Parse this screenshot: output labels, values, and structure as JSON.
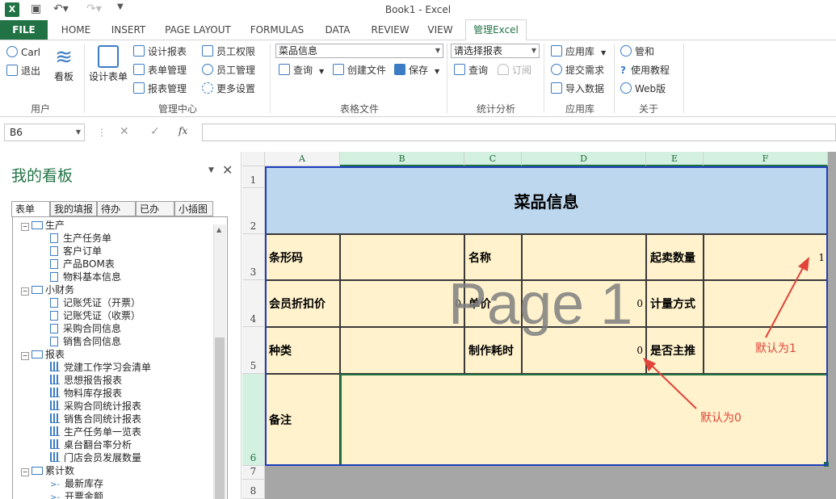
{
  "window": {
    "title": "Book1 - Excel"
  },
  "ribbon_tabs": [
    "FILE",
    "HOME",
    "INSERT",
    "PAGE LAYOUT",
    "FORMULAS",
    "DATA",
    "REVIEW",
    "VIEW",
    "管理Excel"
  ],
  "ribbon": {
    "user": {
      "carl": "Carl",
      "logout": "退出",
      "kanban": "看板",
      "group": "用户"
    },
    "manage": {
      "design_form": "设计表单",
      "design_report": "设计报表",
      "form_mgmt": "表单管理",
      "report_mgmt": "报表管理",
      "employee_perm": "员工权限",
      "employee_mgmt": "员工管理",
      "more_settings": "更多设置",
      "group": "管理中心"
    },
    "table_file": {
      "combo_value": "菜品信息",
      "query": "查询",
      "create_file": "创建文件",
      "save": "保存",
      "group": "表格文件"
    },
    "stats": {
      "combo_value": "请选择报表",
      "query": "查询",
      "subscribe": "订阅",
      "group": "统计分析"
    },
    "apps": {
      "app_store": "应用库",
      "submit_req": "提交需求",
      "import_data": "导入数据",
      "group": "应用库"
    },
    "about": {
      "official": "管和",
      "tutorial": "使用教程",
      "web": "Web版",
      "group": "关于"
    }
  },
  "formula_bar": {
    "name_box": "B6",
    "fx": "fx",
    "cancel": "✕",
    "enter": "✓",
    "value": ""
  },
  "pane": {
    "title": "我的看板",
    "tabs": [
      "表单",
      "我的填报",
      "待办",
      "已办",
      "小插图"
    ],
    "tree": [
      {
        "level": 0,
        "label": "生产",
        "kind": "folder"
      },
      {
        "level": 1,
        "label": "生产任务单",
        "kind": "doc"
      },
      {
        "level": 1,
        "label": "客户订单",
        "kind": "doc"
      },
      {
        "level": 1,
        "label": "产品BOM表",
        "kind": "doc"
      },
      {
        "level": 1,
        "label": "物料基本信息",
        "kind": "doc"
      },
      {
        "level": 0,
        "label": "小财务",
        "kind": "folder"
      },
      {
        "level": 1,
        "label": "记账凭证（开票）",
        "kind": "doc"
      },
      {
        "level": 1,
        "label": "记账凭证（收票）",
        "kind": "doc"
      },
      {
        "level": 1,
        "label": "采购合同信息",
        "kind": "doc"
      },
      {
        "level": 1,
        "label": "销售合同信息",
        "kind": "doc"
      },
      {
        "level": 0,
        "label": "报表",
        "kind": "folder"
      },
      {
        "level": 1,
        "label": "党建工作学习会清单",
        "kind": "chart"
      },
      {
        "level": 1,
        "label": "思想报告报表",
        "kind": "chart"
      },
      {
        "level": 1,
        "label": "物料库存报表",
        "kind": "chart"
      },
      {
        "level": 1,
        "label": "采购合同统计报表",
        "kind": "chart"
      },
      {
        "level": 1,
        "label": "销售合同统计报表",
        "kind": "chart"
      },
      {
        "level": 1,
        "label": "生产任务单一览表",
        "kind": "chart"
      },
      {
        "level": 1,
        "label": "桌台翻台率分析",
        "kind": "chart"
      },
      {
        "level": 1,
        "label": "门店会员发展数量",
        "kind": "chart"
      },
      {
        "level": 0,
        "label": "累计数",
        "kind": "folder"
      },
      {
        "level": 1,
        "label": "最新库存",
        "kind": "arrow"
      },
      {
        "level": 1,
        "label": "开票金额",
        "kind": "arrow"
      }
    ]
  },
  "sheet": {
    "columns": [
      "A",
      "B",
      "C",
      "D",
      "E",
      "F"
    ],
    "rows": [
      "1",
      "2",
      "3",
      "4",
      "5",
      "6",
      "7",
      "8"
    ],
    "title": "菜品信息",
    "labels": {
      "barcode": "条形码",
      "name": "名称",
      "min_qty": "起卖数量",
      "member_price": "会员折扣价",
      "unit_price": "单价",
      "measure": "计量方式",
      "category": "种类",
      "make_time": "制作耗时",
      "featured": "是否主推",
      "remark": "备注"
    },
    "values": {
      "min_qty": "1",
      "member_price": "0",
      "unit_price": "0",
      "make_time": "0"
    },
    "watermark": "Page 1",
    "annotations": {
      "default1": "默认为1",
      "default0": "默认为0"
    }
  },
  "colors": {
    "excel_green": "#217346",
    "header_fill": "#bdd7ee",
    "cell_fill": "#fff2cc",
    "annotation": "#e0443a"
  }
}
